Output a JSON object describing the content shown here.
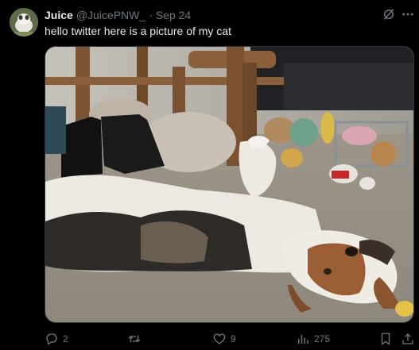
{
  "author": {
    "display_name": "Juice",
    "handle": "@JuicePNW_",
    "separator": "·",
    "date": "Sep 24"
  },
  "tweet": {
    "text": "hello twitter here is a picture of my cat"
  },
  "media": {
    "subject": "dog lying on its back on carpet"
  },
  "actions": {
    "replies": "2",
    "retweets": "",
    "likes": "9",
    "views": "275"
  },
  "colors": {
    "background": "#000000",
    "primary_text": "#e7e9ea",
    "secondary_text": "#71767b",
    "border": "#2f3336"
  },
  "icons": {
    "header_right": [
      "grok-icon",
      "more-icon"
    ],
    "action_bar": [
      "reply-icon",
      "retweet-icon",
      "like-icon",
      "views-icon",
      "bookmark-icon",
      "share-icon"
    ]
  }
}
